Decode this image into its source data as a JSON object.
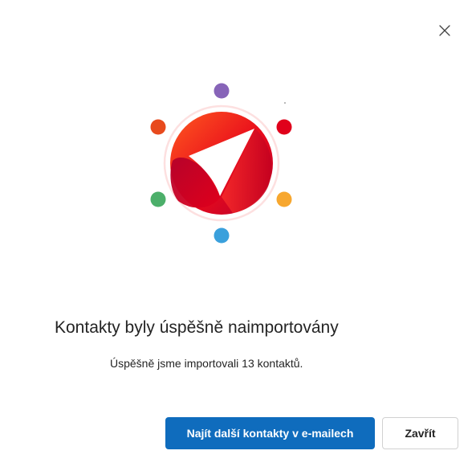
{
  "dialog": {
    "title": "Kontakty byly úspěšně naimportovány",
    "message": "Úspěšně jsme importovali 13 kontaktů.",
    "primary_button": "Najít další kontakty v e-mailech",
    "secondary_button": "Zavřít",
    "close_icon": "close-icon"
  },
  "illustration": {
    "center_icon": "contacts-app-logo",
    "dot_colors": [
      "#8764b8",
      "#e0001b",
      "#f7a72f",
      "#3aa0dc",
      "#4caf6a",
      "#e84a1d"
    ],
    "logo_gradient": [
      "#ff5a1f",
      "#e0001b",
      "#b8002e"
    ]
  },
  "colors": {
    "primary": "#0f6cbd",
    "text": "#242424",
    "border": "#d1d1d1"
  }
}
